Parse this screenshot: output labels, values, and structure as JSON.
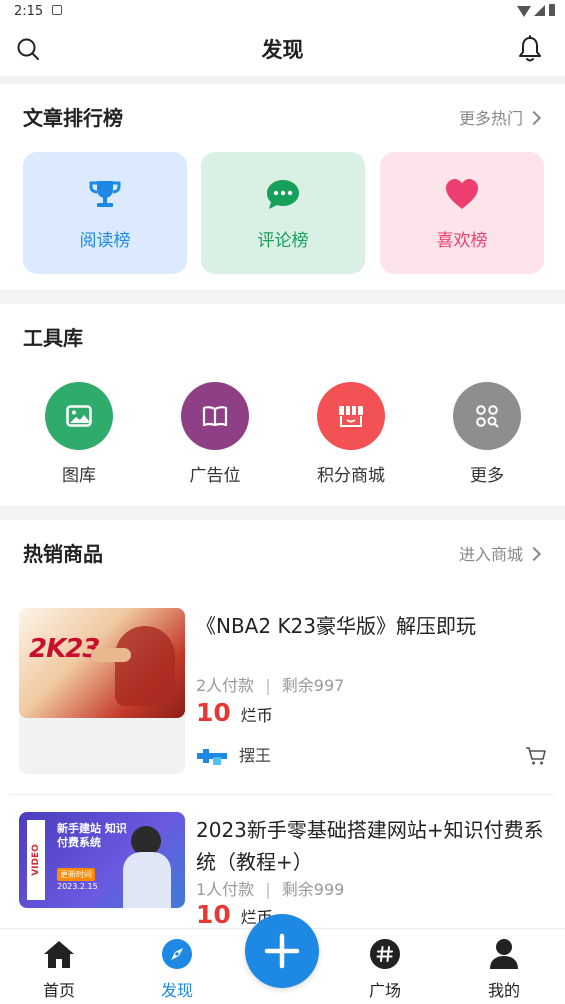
{
  "statusbar": {
    "time": "2:15"
  },
  "header": {
    "title": "发现"
  },
  "ranking": {
    "title": "文章排行榜",
    "more": "更多热门",
    "cards": [
      {
        "label": "阅读榜",
        "icon": "trophy-icon",
        "bg": "#dbeafc",
        "color": "#1e88e5"
      },
      {
        "label": "评论榜",
        "icon": "comment-icon",
        "bg": "#d9f0e4",
        "color": "#16a05a"
      },
      {
        "label": "喜欢榜",
        "icon": "heart-icon",
        "bg": "#fde3ea",
        "color": "#ec3f6f"
      }
    ]
  },
  "tools": {
    "title": "工具库",
    "items": [
      {
        "label": "图库",
        "icon": "image-icon",
        "color": "#2fab6b"
      },
      {
        "label": "广告位",
        "icon": "book-icon",
        "color": "#8e3f86"
      },
      {
        "label": "积分商城",
        "icon": "store-icon",
        "color": "#f25253"
      },
      {
        "label": "更多",
        "icon": "grid-search-icon",
        "color": "#8e8e8e"
      }
    ]
  },
  "products": {
    "title": "热销商品",
    "more": "进入商城",
    "items": [
      {
        "name": "《NBA2 K23豪华版》解压即玩",
        "paid": "2人付款",
        "remain": "剩余997",
        "price": "10",
        "unit": "烂币",
        "seller": "摆王",
        "thumb_text": "2K23"
      },
      {
        "name": "2023新手零基础搭建网站+知识付费系统（教程+）",
        "paid": "1人付款",
        "remain": "剩余999",
        "price": "10",
        "unit": "烂币",
        "thumb_title": "新手建站 知识付费系统",
        "thumb_update": "更新时间",
        "thumb_date": "2023.2.15",
        "thumb_side": "VIDEO"
      }
    ]
  },
  "tabbar": {
    "items": [
      {
        "label": "首页",
        "icon": "home-icon"
      },
      {
        "label": "发现",
        "icon": "compass-icon"
      },
      {
        "label": "广场",
        "icon": "hashtag-icon"
      },
      {
        "label": "我的",
        "icon": "user-icon"
      }
    ],
    "active": "发现",
    "fab_icon": "plus-icon"
  },
  "colors": {
    "accent": "#1e88e5",
    "price": "#e53935"
  }
}
